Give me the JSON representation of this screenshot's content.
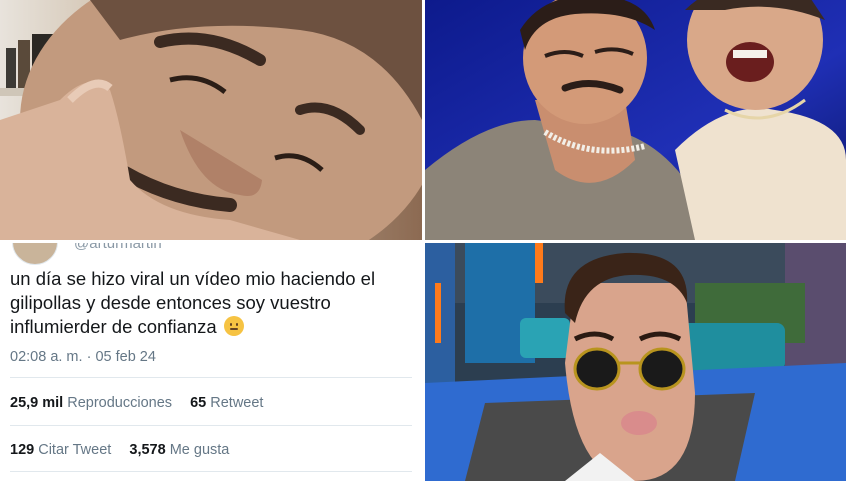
{
  "tweet": {
    "handle": "@arturmartin",
    "text": "un día se hizo viral un vídeo mio haciendo el gilipollas y desde entonces soy vuestro influmierder de confianza",
    "emoji": "slightly-smiling-face-icon",
    "time": "02:08 a. m.",
    "separator": "·",
    "date": "05 feb 24",
    "stats": {
      "views_count": "25,9 mil",
      "views_label": "Reproducciones",
      "retweets_count": "65",
      "retweets_label": "Retweet",
      "quotes_count": "129",
      "quotes_label": "Citar Tweet",
      "likes_count": "3,578",
      "likes_label": "Me gusta"
    }
  },
  "colors": {
    "text_primary": "#14171a",
    "text_secondary": "#657786",
    "divider": "#e1e8ed",
    "studio_blue": "#1a237e"
  }
}
